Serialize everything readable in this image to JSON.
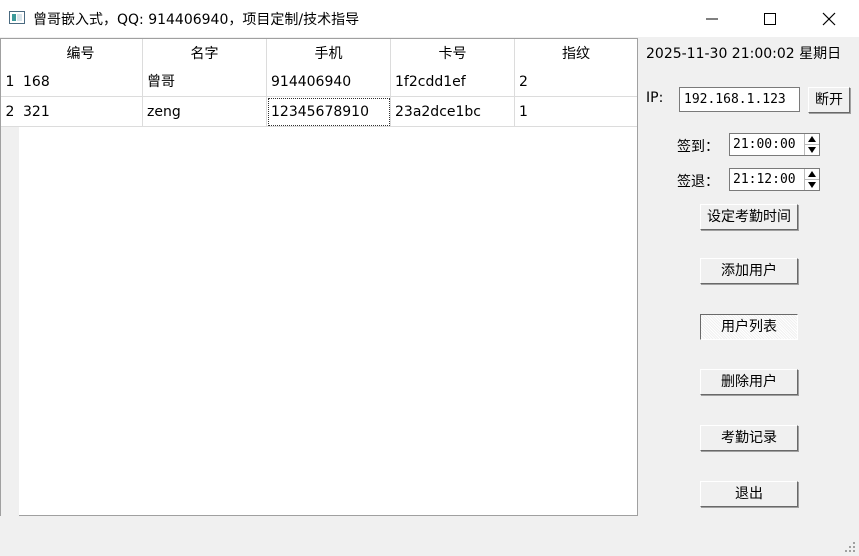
{
  "window": {
    "title": "曾哥嵌入式，QQ: 914406940，项目定制/技术指导"
  },
  "table": {
    "headers": [
      "编号",
      "名字",
      "手机",
      "卡号",
      "指纹"
    ],
    "row_headers": [
      "1",
      "2"
    ],
    "rows": [
      [
        "168",
        "曾哥",
        "914406940",
        "1f2cdd1ef",
        "2"
      ],
      [
        "321",
        "zeng",
        "12345678910",
        "23a2dce1bc",
        "1"
      ]
    ]
  },
  "panel": {
    "datetime": "2025-11-30 21:00:02 星期日",
    "ip_label": "IP:",
    "ip_value": "192.168.1.123",
    "disconnect_label": "断开",
    "checkin_label": "签到：",
    "checkin_time": "21:00:00",
    "checkout_label": "签退：",
    "checkout_time": "21:12:00",
    "set_time_label": "设定考勤时间",
    "add_user_label": "添加用户",
    "user_list_label": "用户列表",
    "delete_user_label": "删除用户",
    "attendance_label": "考勤记录",
    "exit_label": "退出"
  },
  "icons": {
    "app": "app-window-icon",
    "minimize": "minimize-icon",
    "maximize": "maximize-icon",
    "close": "close-icon",
    "spin_up": "spin-up-arrow-icon",
    "spin_down": "spin-down-arrow-icon",
    "grip": "resize-grip-icon"
  }
}
